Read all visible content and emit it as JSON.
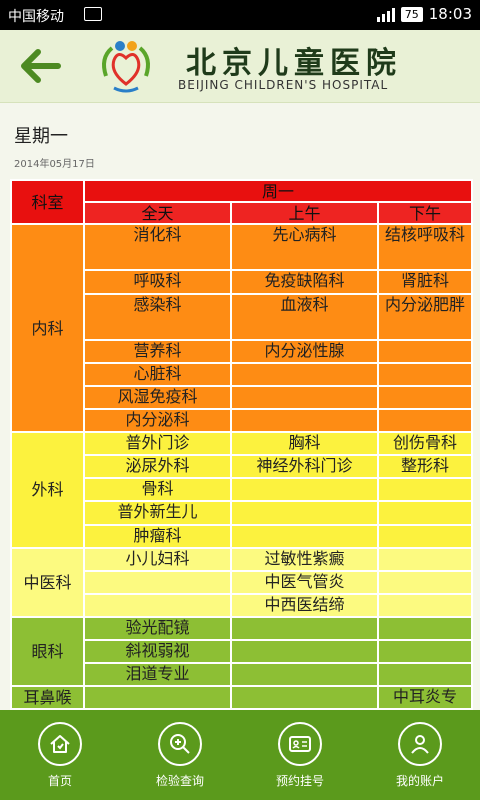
{
  "status_bar": {
    "carrier": "中国移动",
    "battery": "75",
    "time": "18:03"
  },
  "header": {
    "title_cn": "北京儿童医院",
    "title_en": "BEIJING CHILDREN'S HOSPITAL"
  },
  "page": {
    "day": "星期一",
    "date": "2014年05月17日"
  },
  "schedule": {
    "dept_header": "科室",
    "day_header": "周一",
    "col_allday": "全天",
    "col_am": "上午",
    "col_pm": "下午",
    "depts": {
      "neike": "内科",
      "waike": "外科",
      "zhongyi": "中医科",
      "yanke": "眼科",
      "erbihou": "耳鼻喉"
    },
    "rows": {
      "r1": {
        "allday": "消化科",
        "am": "先心病科",
        "pm": "结核呼吸科"
      },
      "r2": {
        "allday": "呼吸科",
        "am": "免疫缺陷科",
        "pm": "肾脏科"
      },
      "r3": {
        "allday": "感染科",
        "am": "血液科",
        "pm": "内分泌肥胖"
      },
      "r4": {
        "allday": "营养科",
        "am": "内分泌性腺",
        "pm": ""
      },
      "r5": {
        "allday": "心脏科",
        "am": "",
        "pm": ""
      },
      "r6": {
        "allday": "风湿免疫科",
        "am": "",
        "pm": ""
      },
      "r7": {
        "allday": "内分泌科",
        "am": "",
        "pm": ""
      },
      "r8": {
        "allday": "普外门诊",
        "am": "胸科",
        "pm": "创伤骨科"
      },
      "r9": {
        "allday": "泌尿外科",
        "am": "神经外科门诊",
        "pm": "整形科"
      },
      "r10": {
        "allday": "骨科",
        "am": "",
        "pm": ""
      },
      "r11": {
        "allday": "普外新生儿",
        "am": "",
        "pm": ""
      },
      "r12": {
        "allday": "肿瘤科",
        "am": "",
        "pm": ""
      },
      "r13": {
        "allday": "小儿妇科",
        "am": "过敏性紫癜",
        "pm": ""
      },
      "r14": {
        "allday": "",
        "am": "中医气管炎",
        "pm": ""
      },
      "r15": {
        "allday": "",
        "am": "中西医结缔",
        "pm": ""
      },
      "r16": {
        "allday": "验光配镜",
        "am": "",
        "pm": ""
      },
      "r17": {
        "allday": "斜视弱视",
        "am": "",
        "pm": ""
      },
      "r18": {
        "allday": "泪道专业",
        "am": "",
        "pm": ""
      },
      "r19": {
        "allday": "",
        "am": "",
        "pm": "中耳炎专"
      }
    }
  },
  "tabs": {
    "home": {
      "label": "首页",
      "icon": "home-icon"
    },
    "check": {
      "label": "检验查询",
      "icon": "magnifier-plus-icon"
    },
    "appointment": {
      "label": "预约挂号",
      "icon": "registration-card-icon"
    },
    "account": {
      "label": "我的账户",
      "icon": "user-icon"
    }
  },
  "colors": {
    "header_red": "#e8100f",
    "internal_orange": "#fe8c14",
    "surgery_yellow": "#fcf23e",
    "tcm_yellow": "#fcfa80",
    "eye_green": "#8dbf34",
    "tabbar_green": "#5b9a1c"
  }
}
